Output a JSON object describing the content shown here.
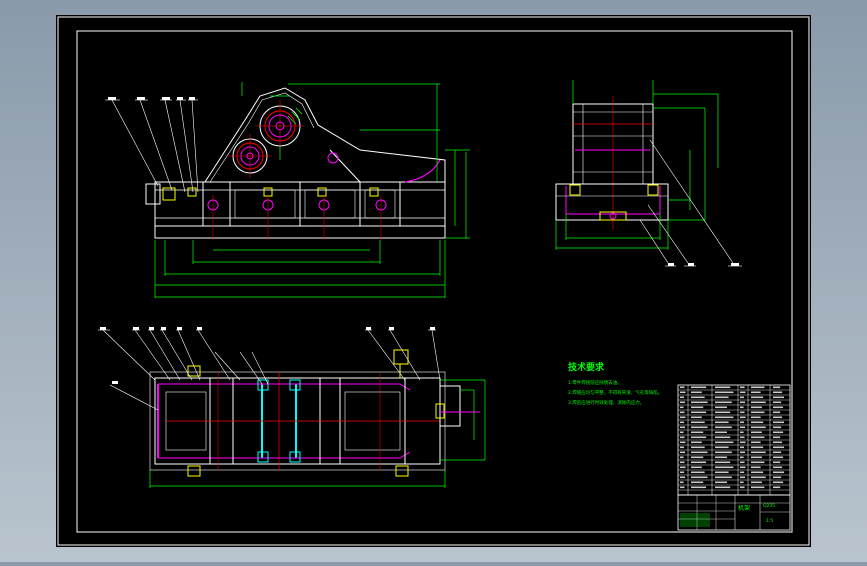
{
  "colors": {
    "background_outer": "#9aa8b6",
    "sheet": "#000000",
    "frame": "#ffffff",
    "line_white": "#ffffff",
    "line_green": "#00ff00",
    "line_yellow": "#ffff00",
    "line_red": "#ff0000",
    "line_magenta": "#ff00ff",
    "line_cyan": "#00ffff"
  },
  "technical_requirements": {
    "title": "技术要求",
    "items": [
      "1.零件焊接前应除锈去油。",
      "2.焊缝应均匀平整，不得有夹渣、气孔等缺陷。",
      "3.焊后应进行时效处理，消除内应力。"
    ]
  },
  "title_block": {
    "drawing_name": "机架",
    "material": "Q235",
    "scale": "1:5"
  }
}
